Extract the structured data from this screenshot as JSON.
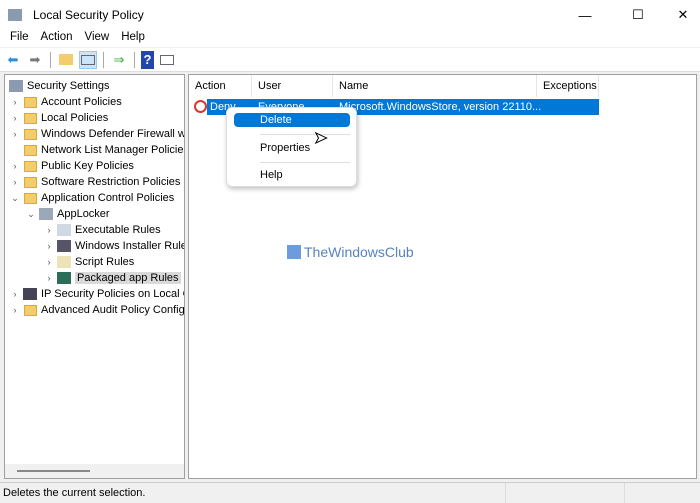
{
  "window": {
    "title": "Local Security Policy",
    "minimize": "—",
    "maximize": "☐",
    "close": "✕"
  },
  "menu": [
    "File",
    "Action",
    "View",
    "Help"
  ],
  "toolbar": {
    "icons": [
      "back-icon",
      "forward-icon",
      "up-folder-icon",
      "show-hide-tree-icon",
      "export-list-icon",
      "help-icon",
      "show-action-pane-icon"
    ]
  },
  "tree": [
    {
      "label": "Security Settings",
      "level": 0,
      "chevron": "",
      "icon": "security-settings-icon"
    },
    {
      "label": "Account Policies",
      "level": 1,
      "chevron": "›",
      "icon": "locked-folder-icon"
    },
    {
      "label": "Local Policies",
      "level": 1,
      "chevron": "›",
      "icon": "locked-folder-icon"
    },
    {
      "label": "Windows Defender Firewall wi",
      "level": 1,
      "chevron": "›",
      "icon": "folder-icon"
    },
    {
      "label": "Network List Manager Policies",
      "level": 1,
      "chevron": "",
      "icon": "folder-icon"
    },
    {
      "label": "Public Key Policies",
      "level": 1,
      "chevron": "›",
      "icon": "folder-icon"
    },
    {
      "label": "Software Restriction Policies",
      "level": 1,
      "chevron": "›",
      "icon": "folder-icon"
    },
    {
      "label": "Application Control Policies",
      "level": 1,
      "chevron": "⌄",
      "icon": "folder-icon"
    },
    {
      "label": "AppLocker",
      "level": 2,
      "chevron": "⌄",
      "icon": "applocker-icon"
    },
    {
      "label": "Executable Rules",
      "level": 3,
      "chevron": "›",
      "icon": "executable-rules-icon"
    },
    {
      "label": "Windows Installer Rules",
      "level": 3,
      "chevron": "›",
      "icon": "installer-rules-icon"
    },
    {
      "label": "Script Rules",
      "level": 3,
      "chevron": "›",
      "icon": "script-rules-icon"
    },
    {
      "label": "Packaged app Rules",
      "level": 3,
      "chevron": "›",
      "icon": "packaged-app-rules-icon",
      "selected": true
    },
    {
      "label": "IP Security Policies on Local Co",
      "level": 1,
      "chevron": "›",
      "icon": "ip-security-icon"
    },
    {
      "label": "Advanced Audit Policy Config",
      "level": 1,
      "chevron": "›",
      "icon": "folder-icon"
    }
  ],
  "table": {
    "columns": [
      "Action",
      "User",
      "Name",
      "Exceptions"
    ],
    "rows": [
      {
        "action": "Deny",
        "user": "Everyone",
        "name": "Microsoft.WindowsStore, version 22110...",
        "exceptions": ""
      }
    ]
  },
  "context_menu": [
    "Delete",
    "Properties",
    "Help"
  ],
  "watermark": "TheWindowsClub",
  "status": "Deletes the current selection.",
  "colors": {
    "selection": "#0078d7",
    "folder": "#f3cd6b"
  }
}
